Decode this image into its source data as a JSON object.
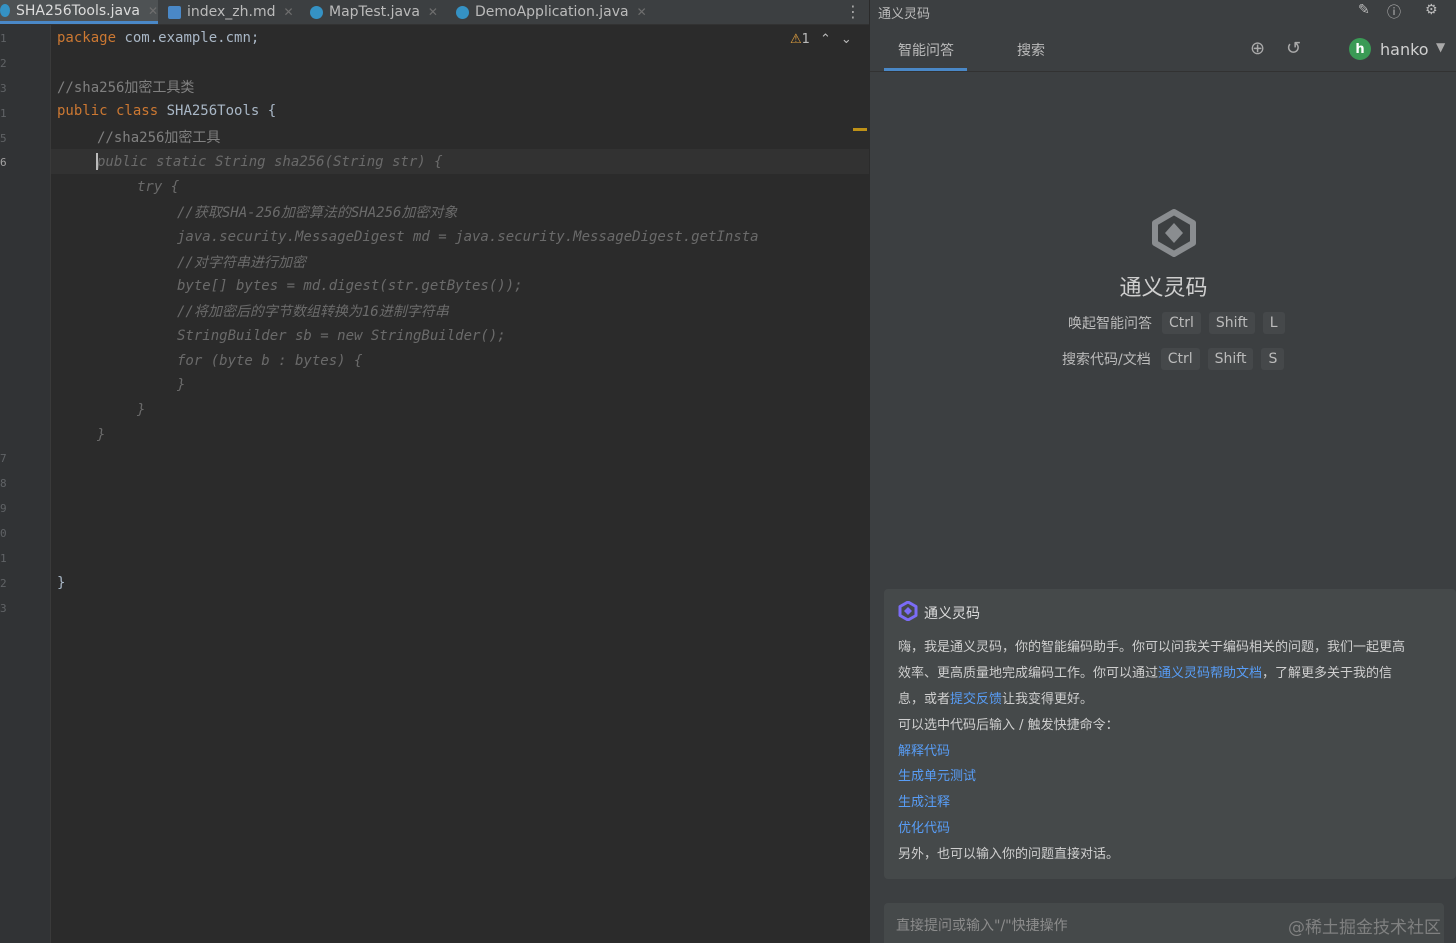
{
  "tabs": [
    {
      "label": "SHA256Tools.java",
      "active": true,
      "color": "#3592c4"
    },
    {
      "label": "index_zh.md",
      "active": false,
      "color": "#4a88c7"
    },
    {
      "label": "MapTest.java",
      "active": false,
      "color": "#3592c4"
    },
    {
      "label": "DemoApplication.java",
      "active": false,
      "color": "#3592c4"
    }
  ],
  "tab_more": "⋮",
  "line_numbers": [
    "1",
    "2",
    "3",
    "4",
    "5",
    "6",
    "7",
    "8",
    "9",
    "0",
    "1",
    "2",
    "3"
  ],
  "code": {
    "l1_kw": "package",
    "l1_rest": " com.example.cmn;",
    "l3": "//sha256加密工具类",
    "l4_kw": "public class",
    "l4_rest": " SHA256Tools {",
    "l5": "//sha256加密工具",
    "l6": "public static String sha256(String str) {",
    "l7": "try {",
    "l8": "//获取SHA-256加密算法的SHA256加密对象",
    "l9": "java.security.MessageDigest md = java.security.MessageDigest.getInsta",
    "l10": "//对字符串进行加密",
    "l11": "byte[] bytes = md.digest(str.getBytes());",
    "l12": "//将加密后的字节数组转换为16进制字符串",
    "l13": "StringBuilder sb = new StringBuilder();",
    "l14": "for (byte b : bytes) {",
    "l15": "}",
    "l16": "}",
    "l17": "}",
    "l18": "}"
  },
  "warnings": {
    "icon": "⚠",
    "count": "1",
    "up": "⌃",
    "down": "⌄"
  },
  "panel": {
    "title": "通义灵码",
    "tabs": [
      "智能问答",
      "搜索"
    ],
    "user": "hanko",
    "user_initial": "h",
    "brand": "通义灵码",
    "shortcuts": [
      {
        "label": "唤起智能问答",
        "keys": [
          "Ctrl",
          "Shift",
          "L"
        ]
      },
      {
        "label": "搜索代码/文档",
        "keys": [
          "Ctrl",
          "Shift",
          "S"
        ]
      }
    ]
  },
  "card": {
    "title": "通义灵码",
    "line1": "嗨，我是通义灵码，你的智能编码助手。你可以问我关于编码相关的问题，我们一起更高",
    "line2_pre": "效率、更高质量地完成编码工作。你可以通过",
    "line2_link": "通义灵码帮助文档",
    "line2_post": "，了解更多关于我的信",
    "line3_pre": "息，或者",
    "line3_link": "提交反馈",
    "line3_post": "让我变得更好。",
    "line4": "可以选中代码后输入 / 触发快捷命令：",
    "commands": [
      "解释代码",
      "生成单元测试",
      "生成注释",
      "优化代码"
    ],
    "line_last": "另外，也可以输入你的问题直接对话。"
  },
  "input": {
    "placeholder": "直接提问或输入\"/\"快捷操作"
  },
  "watermark": "@稀土掘金技术社区"
}
